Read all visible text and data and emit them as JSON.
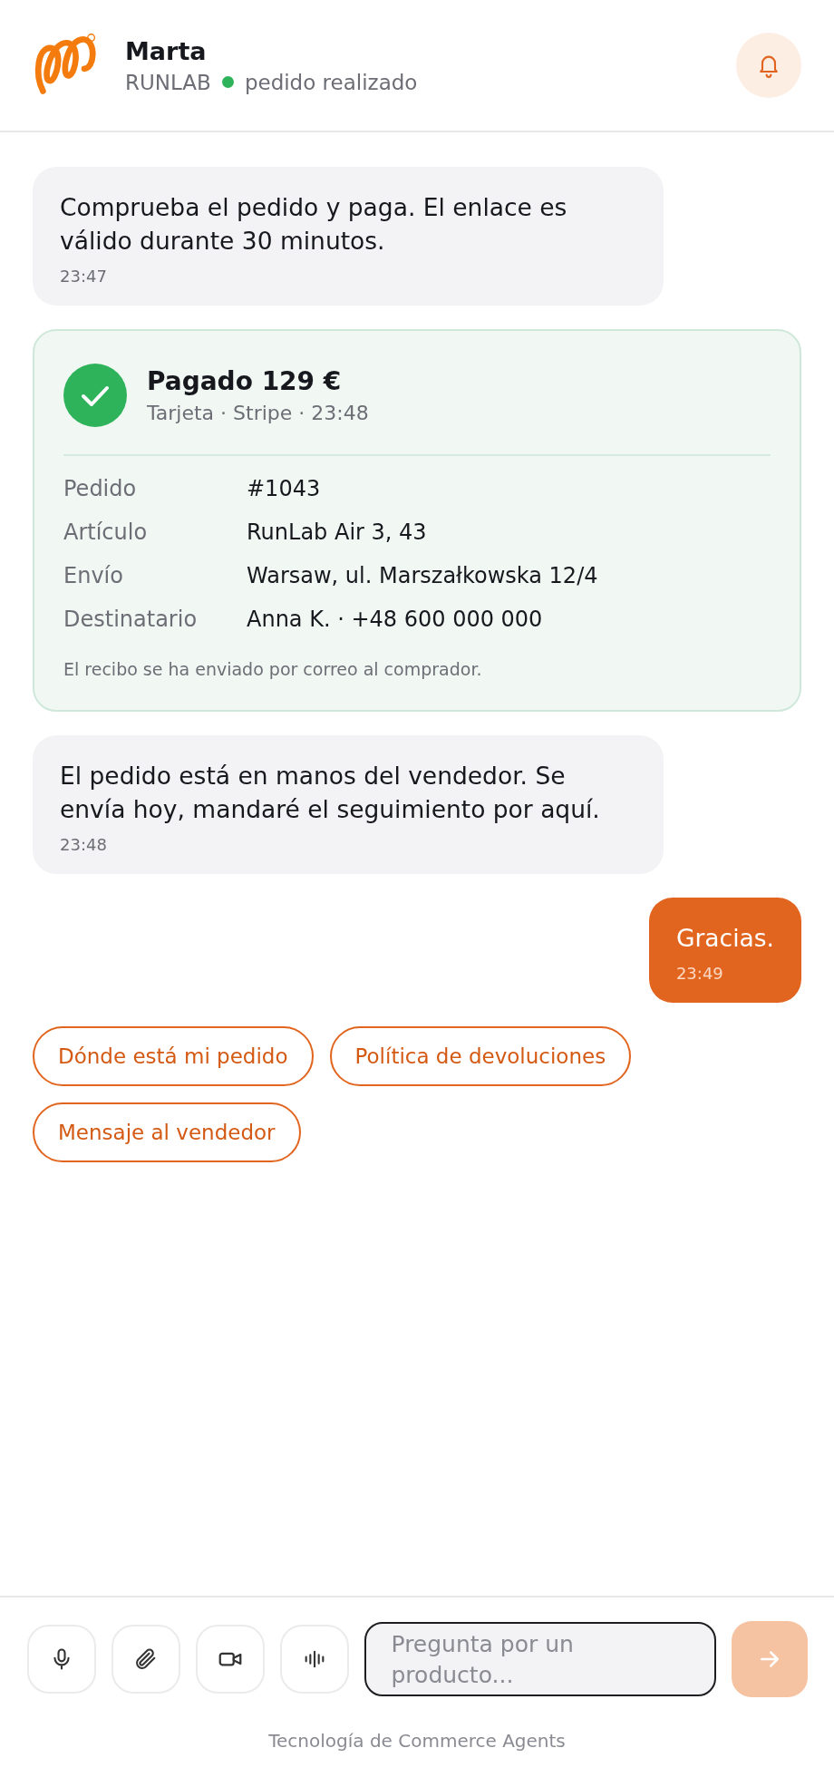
{
  "header": {
    "name": "Marta",
    "brand": "RUNLAB",
    "online": true,
    "status": "pedido realizado"
  },
  "messages": [
    {
      "kind": "agent",
      "text": "Comprueba el pedido y paga. El enlace es válido durante 30 minutos.",
      "time": "23:47"
    },
    {
      "kind": "payment",
      "title": "Pagado 129 €",
      "subtitle": "Tarjeta · Stripe · 23:48",
      "rows": [
        {
          "label": "Pedido",
          "value": "#1043"
        },
        {
          "label": "Artículo",
          "value": "RunLab Air 3, 43"
        },
        {
          "label": "Envío",
          "value": "Warsaw, ul. Marszałkowska 12/4"
        },
        {
          "label": "Destinatario",
          "value": "Anna K. · +48 600 000 000"
        }
      ],
      "note": "El recibo se ha enviado por correo al comprador."
    },
    {
      "kind": "agent",
      "text": "El pedido está en manos del vendedor. Se envía hoy, mandaré el seguimiento por aquí.",
      "time": "23:48"
    },
    {
      "kind": "user",
      "text": "Gracias.",
      "time": "23:49"
    }
  ],
  "suggestions": [
    "Dónde está mi pedido",
    "Política de devoluciones",
    "Mensaje al vendedor"
  ],
  "composer": {
    "placeholder": "Pregunta por un producto...",
    "send_disabled": true
  },
  "footer": "Tecnología de Commerce Agents"
}
